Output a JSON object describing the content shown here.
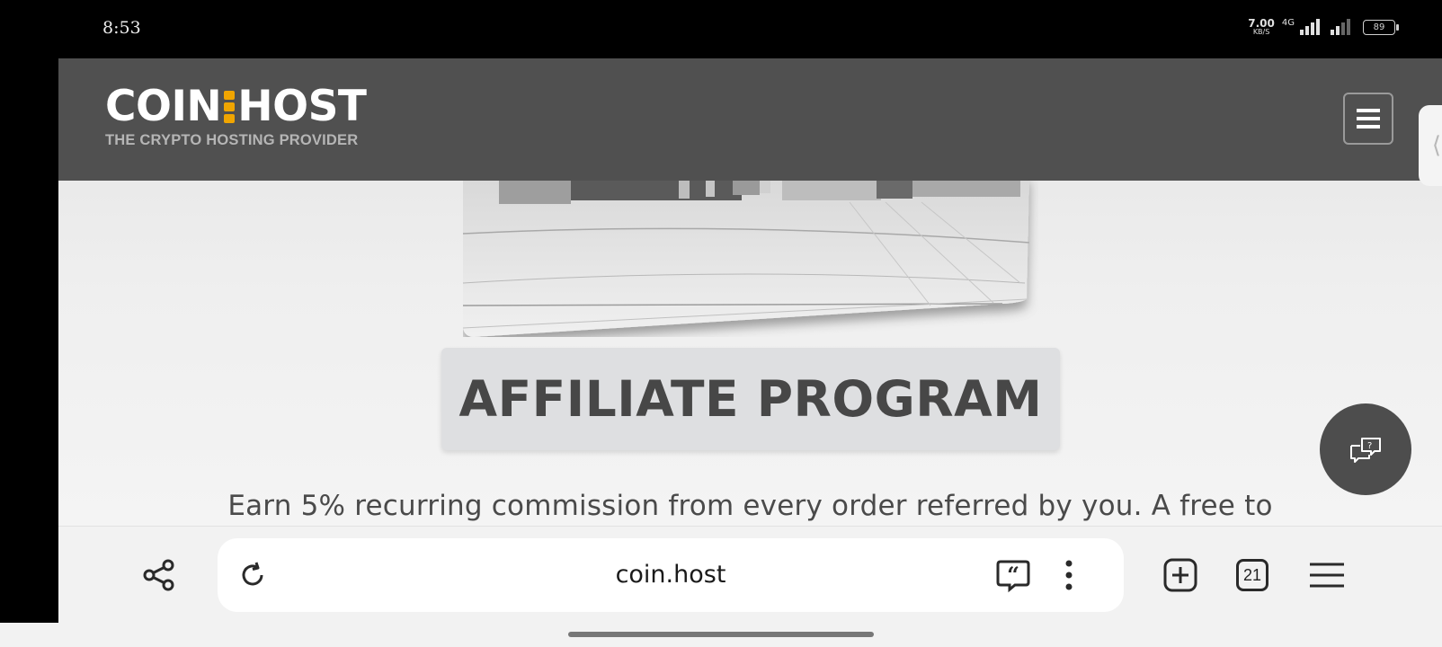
{
  "status_bar": {
    "time": "8:53",
    "net_speed_value": "7.00",
    "net_speed_unit": "KB/S",
    "network_type": "4G",
    "battery": "89"
  },
  "header": {
    "logo_left": "COIN",
    "logo_right": "HOST",
    "tagline": "THE CRYPTO HOSTING PROVIDER",
    "accent_color": "#f0a500"
  },
  "main": {
    "section_title": "AFFILIATE PROGRAM",
    "promo_text": "Earn 5% recurring commission from every order referred by you. A free to"
  },
  "browser": {
    "url": "coin.host",
    "tab_count": "21"
  },
  "icons": {
    "menu": "hamburger-icon",
    "help": "help-chat-icon",
    "share": "share-icon",
    "reload": "reload-icon",
    "quote": "quote-icon",
    "more": "more-vertical-icon",
    "new_tab": "new-tab-icon",
    "tabs": "tabs-icon",
    "browser_menu": "browser-menu-icon"
  }
}
